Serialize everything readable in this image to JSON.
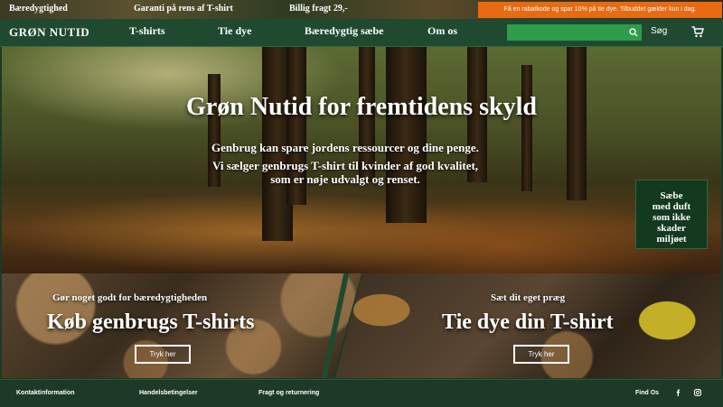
{
  "topbar": {
    "items": [
      "Bæredygtighed",
      "Garanti på rens af T-shirt",
      "Billig fragt 29,-"
    ],
    "promo": "Få en rabatkode og spar 10% på tie dye. Tilbuddet gælder kun i dag."
  },
  "nav": {
    "brand": "GRØN NUTID",
    "links": [
      "T-shirts",
      "Tie dye",
      "Bæredygtig sæbe",
      "Om os"
    ],
    "search_label": "Søg"
  },
  "hero": {
    "title": "Grøn Nutid for fremtidens skyld",
    "lines": [
      "Genbrug kan spare jordens ressourcer og dine penge.",
      "Vi sælger genbrugs T-shirt til kvinder af god kvalitet,",
      "som er  nøje udvalgt og renset."
    ],
    "soap_lines": [
      "Sæbe",
      "med duft",
      "som ikke",
      "skader",
      "miljøet"
    ]
  },
  "promos": {
    "left": {
      "small": "Gør noget godt for bæredygtigheden",
      "big": "Køb genbrugs T-shirts",
      "button": "Tryk her"
    },
    "right": {
      "small": "Sæt dit eget præg",
      "big": "Tie dye din T-shirt",
      "button": "Tryk her"
    }
  },
  "footer": {
    "links": [
      "Kontaktinformation",
      "Handelsbetingelser",
      "Fragt og returnering"
    ],
    "find_us": "Find Os",
    "icons": [
      "facebook-icon",
      "instagram-icon"
    ]
  },
  "colors": {
    "nav_bg": "#1f4a30",
    "search_bg": "#2f9c4c",
    "promo_bg": "#e86a12",
    "footer_bg": "#1c3a26"
  }
}
